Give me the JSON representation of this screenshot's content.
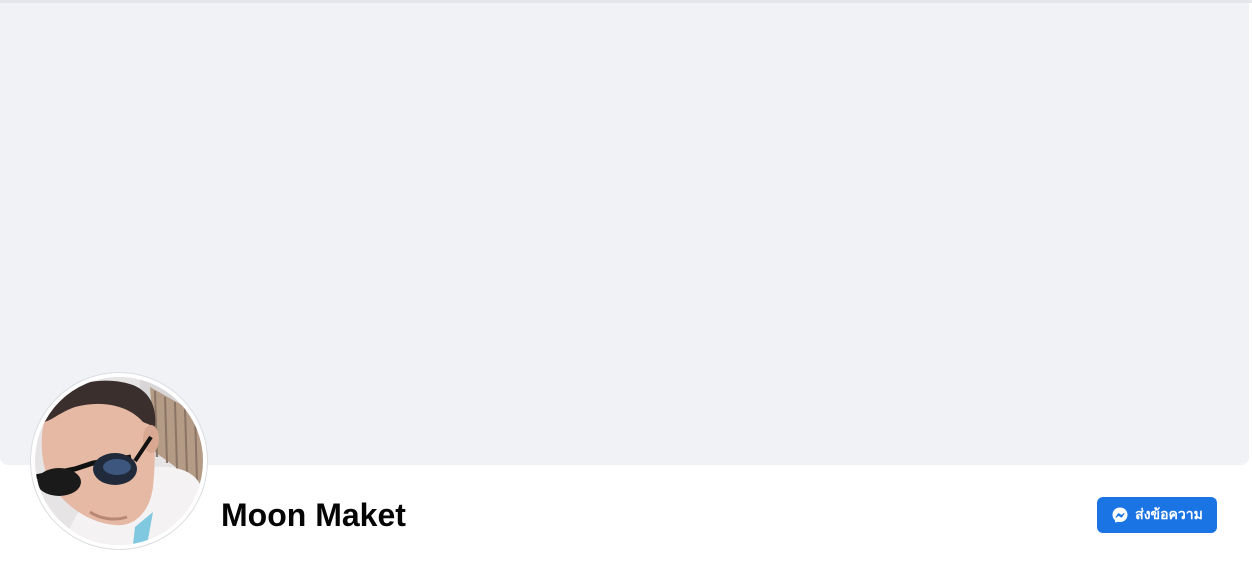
{
  "profile": {
    "name": "Moon Maket"
  },
  "actions": {
    "message_label": "ส่งข้อความ"
  },
  "icons": {
    "message": "messenger-icon"
  },
  "colors": {
    "accent": "#1b74e4",
    "cover_background": "#f0f2f5",
    "page_background": "#ffffff",
    "name_text": "#050505"
  }
}
